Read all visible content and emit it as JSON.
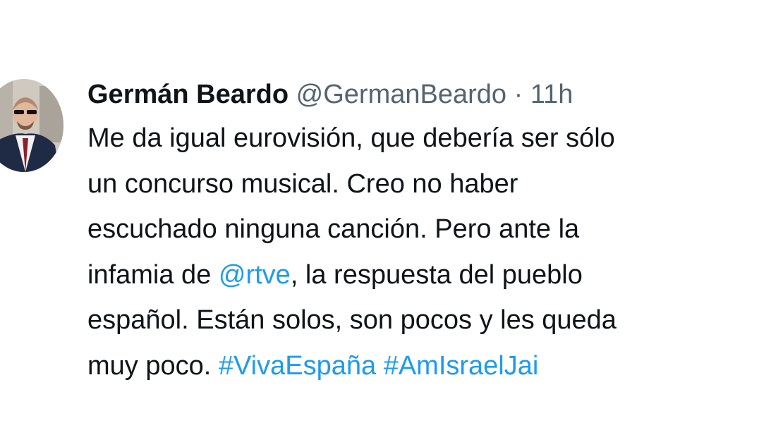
{
  "tweet": {
    "author_name": "Germán Beardo",
    "author_handle": "@GermanBeardo",
    "separator": "·",
    "time": "11h",
    "lines": [
      "Me da igual eurovisión, que debería ser sólo",
      "un concurso musical. Creo no haber",
      "escuchado ninguna canción. Pero ante la"
    ],
    "line4_before": "infamia de ",
    "mention": "@rtve",
    "line4_after": ", la respuesta del pueblo",
    "line5": "español. Están solos, son pocos y les queda",
    "line6_before": "muy poco. ",
    "hashtag_1": "#VivaEspaña",
    "hashtag_2": "#AmIsraelJai"
  },
  "colors": {
    "text": "#0f1419",
    "secondary": "#536471",
    "link": "#1d9bf0"
  },
  "icons": {
    "avatar": "profile-photo"
  }
}
